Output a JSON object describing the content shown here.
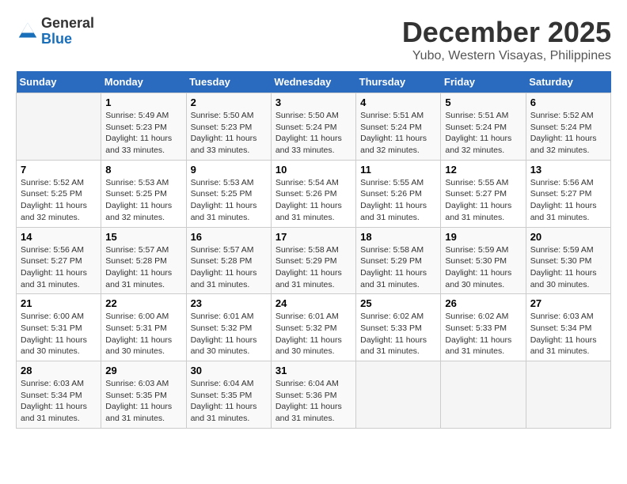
{
  "header": {
    "logo_general": "General",
    "logo_blue": "Blue",
    "title": "December 2025",
    "subtitle": "Yubo, Western Visayas, Philippines"
  },
  "calendar": {
    "days_of_week": [
      "Sunday",
      "Monday",
      "Tuesday",
      "Wednesday",
      "Thursday",
      "Friday",
      "Saturday"
    ],
    "weeks": [
      [
        {
          "day": "",
          "info": ""
        },
        {
          "day": "1",
          "info": "Sunrise: 5:49 AM\nSunset: 5:23 PM\nDaylight: 11 hours\nand 33 minutes."
        },
        {
          "day": "2",
          "info": "Sunrise: 5:50 AM\nSunset: 5:23 PM\nDaylight: 11 hours\nand 33 minutes."
        },
        {
          "day": "3",
          "info": "Sunrise: 5:50 AM\nSunset: 5:24 PM\nDaylight: 11 hours\nand 33 minutes."
        },
        {
          "day": "4",
          "info": "Sunrise: 5:51 AM\nSunset: 5:24 PM\nDaylight: 11 hours\nand 32 minutes."
        },
        {
          "day": "5",
          "info": "Sunrise: 5:51 AM\nSunset: 5:24 PM\nDaylight: 11 hours\nand 32 minutes."
        },
        {
          "day": "6",
          "info": "Sunrise: 5:52 AM\nSunset: 5:24 PM\nDaylight: 11 hours\nand 32 minutes."
        }
      ],
      [
        {
          "day": "7",
          "info": "Sunrise: 5:52 AM\nSunset: 5:25 PM\nDaylight: 11 hours\nand 32 minutes."
        },
        {
          "day": "8",
          "info": "Sunrise: 5:53 AM\nSunset: 5:25 PM\nDaylight: 11 hours\nand 32 minutes."
        },
        {
          "day": "9",
          "info": "Sunrise: 5:53 AM\nSunset: 5:25 PM\nDaylight: 11 hours\nand 31 minutes."
        },
        {
          "day": "10",
          "info": "Sunrise: 5:54 AM\nSunset: 5:26 PM\nDaylight: 11 hours\nand 31 minutes."
        },
        {
          "day": "11",
          "info": "Sunrise: 5:55 AM\nSunset: 5:26 PM\nDaylight: 11 hours\nand 31 minutes."
        },
        {
          "day": "12",
          "info": "Sunrise: 5:55 AM\nSunset: 5:27 PM\nDaylight: 11 hours\nand 31 minutes."
        },
        {
          "day": "13",
          "info": "Sunrise: 5:56 AM\nSunset: 5:27 PM\nDaylight: 11 hours\nand 31 minutes."
        }
      ],
      [
        {
          "day": "14",
          "info": "Sunrise: 5:56 AM\nSunset: 5:27 PM\nDaylight: 11 hours\nand 31 minutes."
        },
        {
          "day": "15",
          "info": "Sunrise: 5:57 AM\nSunset: 5:28 PM\nDaylight: 11 hours\nand 31 minutes."
        },
        {
          "day": "16",
          "info": "Sunrise: 5:57 AM\nSunset: 5:28 PM\nDaylight: 11 hours\nand 31 minutes."
        },
        {
          "day": "17",
          "info": "Sunrise: 5:58 AM\nSunset: 5:29 PM\nDaylight: 11 hours\nand 31 minutes."
        },
        {
          "day": "18",
          "info": "Sunrise: 5:58 AM\nSunset: 5:29 PM\nDaylight: 11 hours\nand 31 minutes."
        },
        {
          "day": "19",
          "info": "Sunrise: 5:59 AM\nSunset: 5:30 PM\nDaylight: 11 hours\nand 30 minutes."
        },
        {
          "day": "20",
          "info": "Sunrise: 5:59 AM\nSunset: 5:30 PM\nDaylight: 11 hours\nand 30 minutes."
        }
      ],
      [
        {
          "day": "21",
          "info": "Sunrise: 6:00 AM\nSunset: 5:31 PM\nDaylight: 11 hours\nand 30 minutes."
        },
        {
          "day": "22",
          "info": "Sunrise: 6:00 AM\nSunset: 5:31 PM\nDaylight: 11 hours\nand 30 minutes."
        },
        {
          "day": "23",
          "info": "Sunrise: 6:01 AM\nSunset: 5:32 PM\nDaylight: 11 hours\nand 30 minutes."
        },
        {
          "day": "24",
          "info": "Sunrise: 6:01 AM\nSunset: 5:32 PM\nDaylight: 11 hours\nand 30 minutes."
        },
        {
          "day": "25",
          "info": "Sunrise: 6:02 AM\nSunset: 5:33 PM\nDaylight: 11 hours\nand 31 minutes."
        },
        {
          "day": "26",
          "info": "Sunrise: 6:02 AM\nSunset: 5:33 PM\nDaylight: 11 hours\nand 31 minutes."
        },
        {
          "day": "27",
          "info": "Sunrise: 6:03 AM\nSunset: 5:34 PM\nDaylight: 11 hours\nand 31 minutes."
        }
      ],
      [
        {
          "day": "28",
          "info": "Sunrise: 6:03 AM\nSunset: 5:34 PM\nDaylight: 11 hours\nand 31 minutes."
        },
        {
          "day": "29",
          "info": "Sunrise: 6:03 AM\nSunset: 5:35 PM\nDaylight: 11 hours\nand 31 minutes."
        },
        {
          "day": "30",
          "info": "Sunrise: 6:04 AM\nSunset: 5:35 PM\nDaylight: 11 hours\nand 31 minutes."
        },
        {
          "day": "31",
          "info": "Sunrise: 6:04 AM\nSunset: 5:36 PM\nDaylight: 11 hours\nand 31 minutes."
        },
        {
          "day": "",
          "info": ""
        },
        {
          "day": "",
          "info": ""
        },
        {
          "day": "",
          "info": ""
        }
      ]
    ]
  }
}
